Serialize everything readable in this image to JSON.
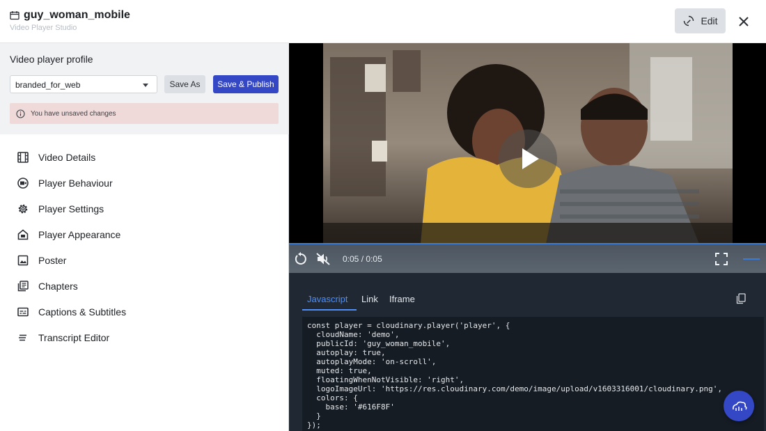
{
  "header": {
    "title": "guy_woman_mobile",
    "subtitle": "Video Player Studio",
    "edit_label": "Edit",
    "title_icon": "calendar-icon",
    "edit_icon": "edit-rotate-icon",
    "close_icon": "close-icon"
  },
  "profile": {
    "title": "Video player profile",
    "selected": "branded_for_web",
    "save_as_label": "Save As",
    "publish_label": "Save & Publish",
    "warning": "You have unsaved changes",
    "accent_color": "#3448c5",
    "warning_bg": "#f0d9d9"
  },
  "menu": [
    {
      "label": "Video Details",
      "icon": "film-icon"
    },
    {
      "label": "Player Behaviour",
      "icon": "player-behaviour-icon"
    },
    {
      "label": "Player Settings",
      "icon": "gear-icon"
    },
    {
      "label": "Player Appearance",
      "icon": "home-appearance-icon"
    },
    {
      "label": "Poster",
      "icon": "image-icon"
    },
    {
      "label": "Chapters",
      "icon": "chapters-icon"
    },
    {
      "label": "Captions & Subtitles",
      "icon": "captions-icon"
    },
    {
      "label": "Transcript Editor",
      "icon": "transcript-icon"
    }
  ],
  "player": {
    "current_time": "0:05",
    "separator": "/",
    "duration": "0:05",
    "progress": 1.0
  },
  "code_panel": {
    "tabs": [
      "Javascript",
      "Link",
      "Iframe"
    ],
    "active_tab": "Javascript",
    "lines": [
      "const player = cloudinary.player('player', {",
      "  cloudName: 'demo',",
      "  publicId: 'guy_woman_mobile',",
      "  autoplay: true,",
      "  autoplayMode: 'on-scroll',",
      "  muted: true,",
      "  floatingWhenNotVisible: 'right',",
      "  logoImageUrl: 'https://res.cloudinary.com/demo/image/upload/v1603316001/cloudinary.png',",
      "  colors: {",
      "    base: '#616F8F'",
      "  }",
      "});"
    ]
  }
}
